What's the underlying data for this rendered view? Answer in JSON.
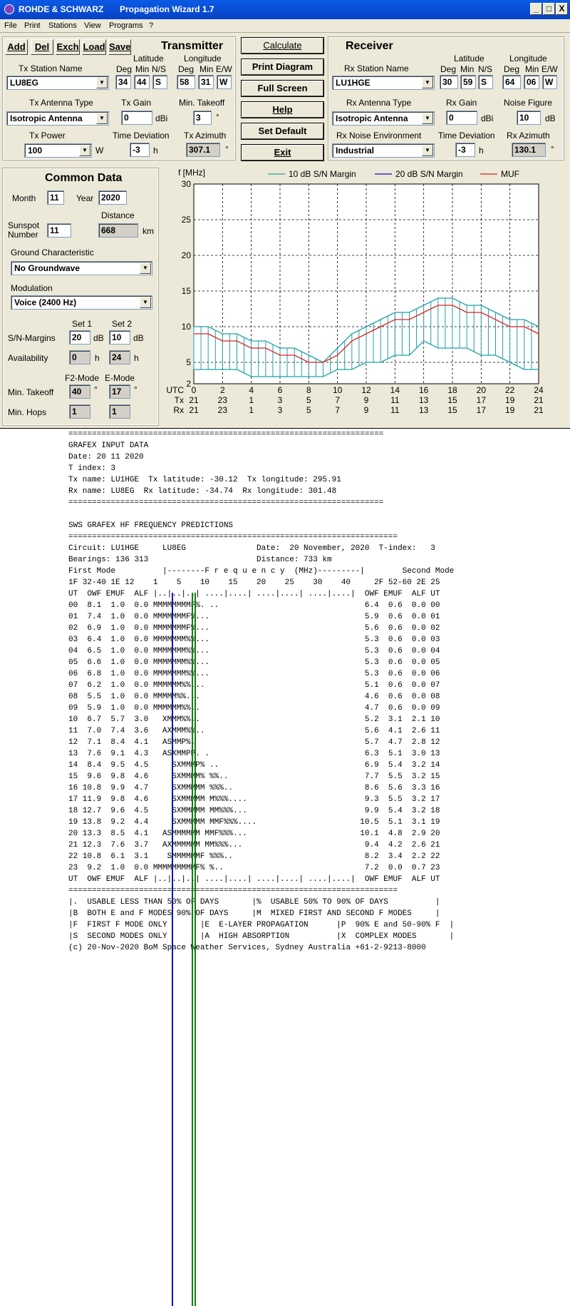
{
  "window": {
    "title_left": "ROHDE & SCHWARZ",
    "title_main": "Propagation Wizard  1.7",
    "btn_min": "_",
    "btn_max": "□",
    "btn_close": "X"
  },
  "menu": [
    "File",
    "Print",
    "Stations",
    "View",
    "Programs",
    "?"
  ],
  "toolbar": [
    "Add",
    "Del",
    "Exch",
    "Load",
    "Save"
  ],
  "actions": [
    "Calculate",
    "Print Diagram",
    "Full Screen",
    "Help",
    "Set Default",
    "Exit"
  ],
  "transmitter": {
    "header": "Transmitter",
    "lat_label": "Latitude",
    "lon_label": "Longitude",
    "deg": "Deg",
    "min": "Min",
    "ns": "N/S",
    "ew": "E/W",
    "station_label": "Tx Station Name",
    "station": "LU8EG",
    "lat_deg": "34",
    "lat_min": "44",
    "lat_ns": "S",
    "lon_deg": "58",
    "lon_min": "31",
    "lon_ew": "W",
    "antenna_label": "Tx Antenna Type",
    "antenna": "Isotropic Antenna",
    "gain_label": "Tx Gain",
    "gain": "0",
    "gain_unit": "dBi",
    "takeoff_label": "Min. Takeoff",
    "takeoff": "3",
    "deg_sym": "°",
    "power_label": "Tx Power",
    "power": "100",
    "power_unit": "W",
    "timedev_label": "Time Deviation",
    "timedev": "-3",
    "timedev_unit": "h",
    "azimuth_label": "Tx Azimuth",
    "azimuth": "307.1"
  },
  "receiver": {
    "header": "Receiver",
    "lat_label": "Latitude",
    "lon_label": "Longitude",
    "deg": "Deg",
    "min": "Min",
    "ns": "N/S",
    "ew": "E/W",
    "station_label": "Rx Station Name",
    "station": "LU1HGE",
    "lat_deg": "30",
    "lat_min": "59",
    "lat_ns": "S",
    "lon_deg": "64",
    "lon_min": "06",
    "lon_ew": "W",
    "antenna_label": "Rx Antenna Type",
    "antenna": "Isotropic Antenna",
    "gain_label": "Rx Gain",
    "gain": "0",
    "gain_unit": "dBi",
    "noise_label": "Noise Figure",
    "noise": "10",
    "noise_unit": "dB",
    "env_label": "Rx Noise Environment",
    "env": "Industrial",
    "timedev_label": "Time Deviation",
    "timedev": "-3",
    "timedev_unit": "h",
    "azimuth_label": "Rx Azimuth",
    "azimuth": "130.1",
    "deg_sym": "°"
  },
  "common": {
    "header": "Common Data",
    "month_label": "Month",
    "month": "11",
    "year_label": "Year",
    "year": "2020",
    "distance_label": "Distance",
    "sunspot_label1": "Sunspot",
    "sunspot_label2": "Number",
    "sunspot": "11",
    "distance": "668",
    "distance_unit": "km",
    "ground_label": "Ground Characteristic",
    "ground": "No Groundwave",
    "mod_label": "Modulation",
    "mod": "Voice   (2400 Hz)",
    "set1": "Set 1",
    "set2": "Set 2",
    "snm_label": "S/N-Margins",
    "snm1": "20",
    "snm2": "10",
    "db": "dB",
    "avail_label": "Availability",
    "avail1": "0",
    "avail2": "24",
    "h": "h",
    "f2mode": "F2-Mode",
    "emode": "E-Mode",
    "takeoff_label": "Min. Takeoff",
    "takeoff1": "40",
    "takeoff2": "17",
    "deg_sym": "°",
    "hops_label": "Min. Hops",
    "hops1": "1",
    "hops2": "1"
  },
  "chart_data": {
    "type": "line",
    "ylabel": "f [MHz]",
    "ylim": [
      2,
      30
    ],
    "yticks": [
      2,
      5,
      10,
      15,
      20,
      25,
      30
    ],
    "x": [
      0,
      1,
      2,
      3,
      4,
      5,
      6,
      7,
      8,
      9,
      10,
      11,
      12,
      13,
      14,
      15,
      16,
      17,
      18,
      19,
      20,
      21,
      22,
      23,
      24
    ],
    "xticks": [
      0,
      2,
      4,
      6,
      8,
      10,
      12,
      14,
      16,
      18,
      20,
      22,
      24
    ],
    "row_labels": [
      "UTC",
      "Tx",
      "Rx"
    ],
    "utc_labels": [
      "0",
      "2",
      "4",
      "6",
      "8",
      "10",
      "12",
      "14",
      "16",
      "18",
      "20",
      "22",
      "24"
    ],
    "tx_labels": [
      "21",
      "23",
      "1",
      "3",
      "5",
      "7",
      "9",
      "11",
      "13",
      "15",
      "17",
      "19",
      "21"
    ],
    "rx_labels": [
      "21",
      "23",
      "1",
      "3",
      "5",
      "7",
      "9",
      "11",
      "13",
      "15",
      "17",
      "19",
      "21"
    ],
    "legend": [
      "10 dB S/N Margin",
      "20 dB S/N Margin",
      "MUF"
    ],
    "colors": {
      "band": "#20a0a8",
      "snm20": "#1010c0",
      "muf": "#e02020"
    },
    "series": [
      {
        "name": "MUF",
        "values": [
          9,
          9,
          8,
          8,
          7,
          7,
          6,
          6,
          5,
          5,
          6,
          8,
          9,
          10,
          11,
          11,
          12,
          13,
          13,
          12,
          12,
          11,
          10,
          10,
          9
        ]
      },
      {
        "name": "10 dB S/N Margin upper",
        "values": [
          10,
          10,
          9,
          9,
          8,
          8,
          7,
          7,
          6,
          5,
          7,
          9,
          10,
          11,
          12,
          12,
          13,
          14,
          14,
          13,
          13,
          12,
          11,
          11,
          10
        ]
      },
      {
        "name": "10 dB S/N Margin lower",
        "values": [
          4,
          4,
          4,
          4,
          3,
          3,
          3,
          3,
          3,
          3,
          4,
          4,
          5,
          5,
          6,
          6,
          8,
          7,
          7,
          7,
          6,
          6,
          5,
          4,
          4
        ]
      }
    ],
    "grid": true,
    "legend_position": "top"
  },
  "report_text": "===================================================================\nGRAFEX INPUT DATA\nDate: 20 11 2020\nT index: 3\nTx name: LU1HGE  Tx latitude: -30.12  Tx longitude: 295.91\nRx name: LU8EG  Rx latitude: -34.74  Rx longitude: 301.48\n===================================================================\n\nSWS GRAFEX HF FREQUENCY PREDICTIONS\n======================================================================\nCircuit: LU1HGE     LU8EG               Date:  20 November, 2020  T-index:   3\nBearings: 136 313                       Distance: 733 km\nFirst Mode          |--------F r e q u e n c y  (MHz)---------|        Second Mode\n1F 32-40 1E 12    1    5    10    15    20    25    30    40     2F 52-60 2E 25\nUT  OWF EMUF  ALF |..|..|..| ....|....| ....|....| ....|....|  OWF EMUF  ALF UT\n00  8.1  1.0  0.0 MMMMMMMMF%. ..                               6.4  0.6  0.0 00\n01  7.4  1.0  0.0 MMMMMMMF%...                                 5.9  0.6  0.0 01\n02  6.9  1.0  0.0 MMMMMMMF%...                                 5.6  0.6  0.0 02\n03  6.4  1.0  0.0 MMMMMMM%%...                                 5.3  0.6  0.0 03\n04  6.5  1.0  0.0 MMMMMMM%%...                                 5.3  0.6  0.0 04\n05  6.6  1.0  0.0 MMMMMMM%%...                                 5.3  0.6  0.0 05\n06  6.8  1.0  0.0 MMMMMMM%%...                                 5.3  0.6  0.0 06\n07  6.2  1.0  0.0 MMMMMM%%...                                  5.1  0.6  0.0 07\n08  5.5  1.0  0.0 MMMMM%%...                                   4.6  0.6  0.0 08\n09  5.9  1.0  0.0 MMMMMM%%..                                   4.7  0.6  0.0 09\n10  6.7  5.7  3.0   XMMM%%..                                   5.2  3.1  2.1 10\n11  7.0  7.4  3.6   AXMMM%%..                                  5.6  4.1  2.6 11\n12  7.1  8.4  4.1   ASMMP%.                                    5.7  4.7  2.8 12\n13  7.6  9.1  4.3   ASXMMPP. .                                 6.3  5.1  3.0 13\n14  8.4  9.5  4.5     SXMMMP% ..                               6.9  5.4  3.2 14\n15  9.6  9.8  4.6     SXMMMM% %%..                             7.7  5.5  3.2 15\n16 10.8  9.9  4.7     SXMMMMM %%%..                            8.6  5.6  3.3 16\n17 11.9  9.8  4.6     SXMMMMM M%%%....                         9.3  5.5  3.2 17\n18 12.7  9.6  4.5     SXMMMMM MM%%%...                         9.9  5.4  3.2 18\n19 13.8  9.2  4.4     SXMMMMM MMF%%%....                      10.5  5.1  3.1 19\n20 13.3  8.5  4.1   ASMMMMMM MMF%%%...                        10.1  4.8  2.9 20\n21 12.3  7.6  3.7   AXMMMMMM MM%%%...                          9.4  4.2  2.6 21\n22 10.8  6.1  3.1    SMMMMMMF %%%..                            8.2  3.4  2.2 22\n23  9.2  1.0  0.0 MMMMMMMMMF% %..                              7.2  0.0  0.7 23\nUT  OWF EMUF  ALF |..|..|..| ....|....| ....|....| ....|....|  OWF EMUF  ALF UT\n======================================================================\n|.  USABLE LESS THAN 50% OF DAYS       |%  USABLE 50% TO 90% OF DAYS          |\n|B  BOTH E and F MODES 90% OF DAYS     |M  MIXED FIRST AND SECOND F MODES     |\n|F  FIRST F MODE ONLY       |E  E-LAYER PROPAGATION      |P  90% E and 50-90% F  |\n|S  SECOND MODES ONLY       |A  HIGH ABSORPTION          |X  COMPLEX MODES       |\n(c) 20-Nov-2020 BoM Space Weather Services, Sydney Australia +61-2-9213-8000"
}
